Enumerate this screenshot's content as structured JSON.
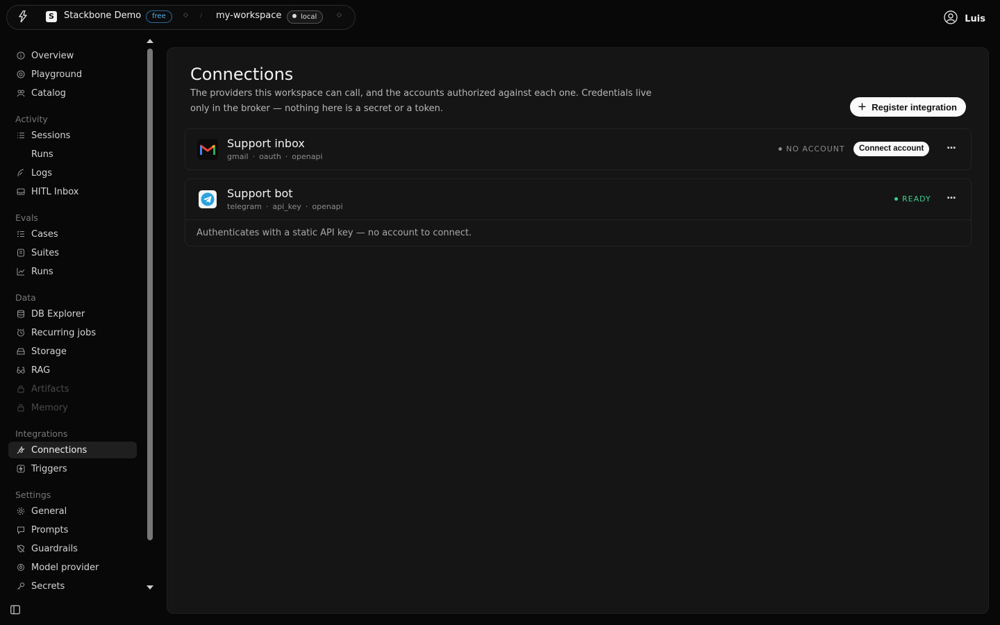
{
  "topbar": {
    "org_name": "Stackbone Demo",
    "org_initial": "S",
    "plan_badge": "free",
    "workspace_name": "my-workspace",
    "env_badge": "local",
    "user_name": "Luis"
  },
  "sidebar": {
    "items_top": [
      {
        "label": "Overview",
        "icon": "info-icon"
      },
      {
        "label": "Playground",
        "icon": "playground-icon"
      },
      {
        "label": "Catalog",
        "icon": "catalog-icon"
      }
    ],
    "sections": [
      {
        "label": "Activity",
        "items": [
          {
            "label": "Sessions",
            "icon": "list-icon"
          },
          {
            "label": "Runs",
            "icon": "runs-icon"
          },
          {
            "label": "Logs",
            "icon": "logs-icon"
          },
          {
            "label": "HITL Inbox",
            "icon": "inbox-icon"
          }
        ]
      },
      {
        "label": "Evals",
        "items": [
          {
            "label": "Cases",
            "icon": "checklist-icon"
          },
          {
            "label": "Suites",
            "icon": "suites-icon"
          },
          {
            "label": "Runs",
            "icon": "chart-icon"
          }
        ]
      },
      {
        "label": "Data",
        "items": [
          {
            "label": "DB Explorer",
            "icon": "database-icon"
          },
          {
            "label": "Recurring jobs",
            "icon": "clock-icon"
          },
          {
            "label": "Storage",
            "icon": "storage-icon"
          },
          {
            "label": "RAG",
            "icon": "rag-icon"
          },
          {
            "label": "Artifacts",
            "icon": "lock-icon"
          },
          {
            "label": "Memory",
            "icon": "lock-icon"
          }
        ]
      },
      {
        "label": "Integrations",
        "items": [
          {
            "label": "Connections",
            "icon": "plug-icon"
          },
          {
            "label": "Triggers",
            "icon": "trigger-icon"
          }
        ]
      },
      {
        "label": "Settings",
        "items": [
          {
            "label": "General",
            "icon": "gear-icon"
          },
          {
            "label": "Prompts",
            "icon": "prompt-icon"
          },
          {
            "label": "Guardrails",
            "icon": "shield-icon"
          },
          {
            "label": "Model provider",
            "icon": "model-icon"
          },
          {
            "label": "Secrets",
            "icon": "key-icon"
          }
        ]
      }
    ],
    "active": "Connections"
  },
  "main": {
    "title": "Connections",
    "description": "The providers this workspace can call, and the accounts authorized against each one. Credentials live only in the broker — nothing here is a secret or a token.",
    "register_label": "Register integration",
    "connections": [
      {
        "name": "Support inbox",
        "provider": "gmail",
        "auth": "oauth",
        "spec": "openapi",
        "status": "NO ACCOUNT",
        "status_color": "#8a8a8a",
        "action_label": "Connect account",
        "more_label": "..."
      },
      {
        "name": "Support bot",
        "provider": "telegram",
        "auth": "api_key",
        "spec": "openapi",
        "status": "READY",
        "status_color": "#3ecf8e",
        "note": "Authenticates with a static API key — no account to connect.",
        "more_label": "..."
      }
    ]
  }
}
